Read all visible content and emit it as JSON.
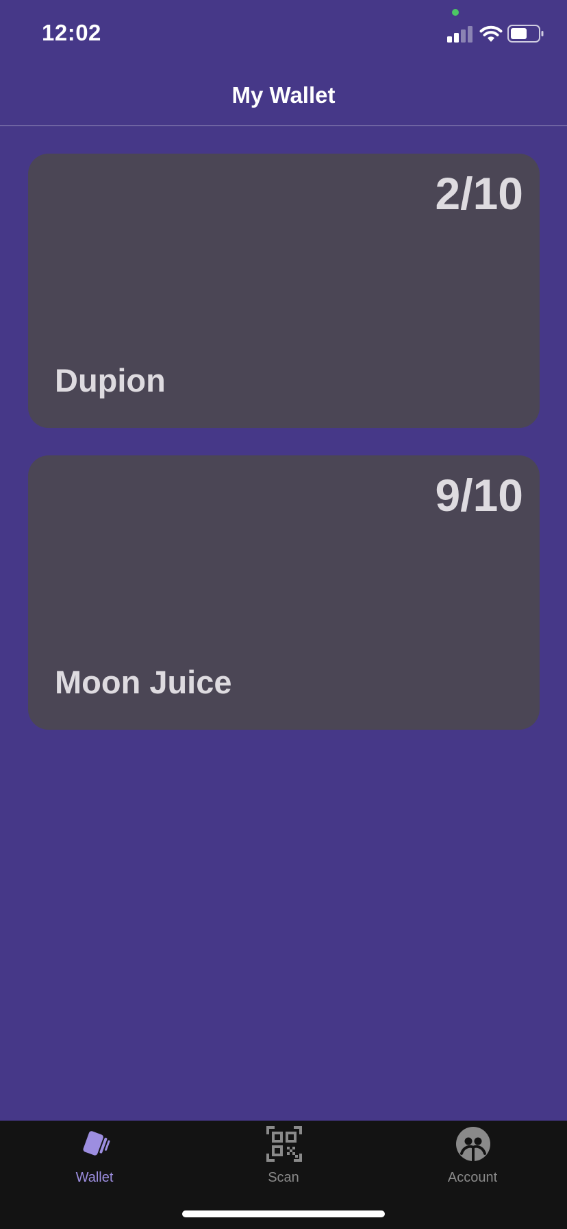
{
  "status_bar": {
    "time": "12:02",
    "icons": [
      "privacy-dot",
      "signal-icon",
      "wifi-icon",
      "battery-icon"
    ],
    "battery_level": 0.55
  },
  "nav": {
    "title": "My Wallet"
  },
  "cards": [
    {
      "name": "Dupion",
      "count": "2/10"
    },
    {
      "name": "Moon Juice",
      "count": "9/10"
    }
  ],
  "tab_bar": {
    "tabs": [
      {
        "label": "Wallet",
        "icon": "wallet-icon",
        "selected": true
      },
      {
        "label": "Scan",
        "icon": "qr-code-icon",
        "selected": false
      },
      {
        "label": "Account",
        "icon": "account-icon",
        "selected": false
      }
    ]
  },
  "colors": {
    "background": "#463888",
    "card": "#4b4655",
    "card_text": "#dedbe0",
    "tab_bar": "#131313",
    "tab_active": "#9d8ee0",
    "tab_inactive": "#8a8a8a",
    "privacy_dot": "#4cc764"
  }
}
